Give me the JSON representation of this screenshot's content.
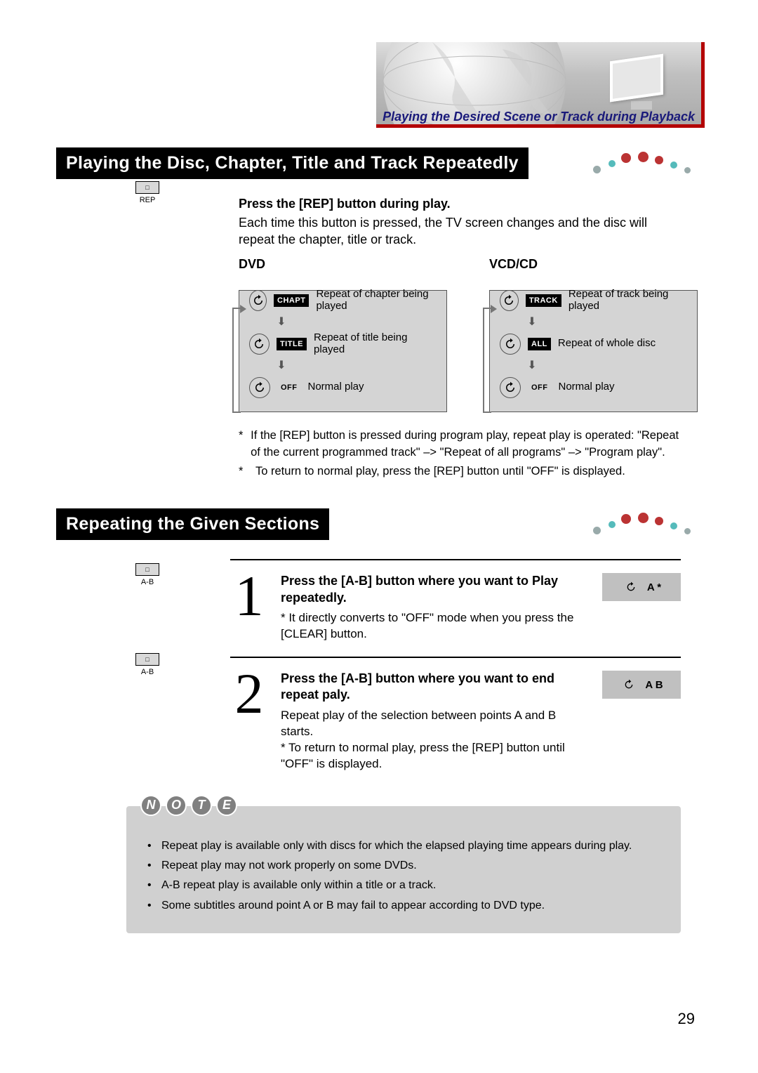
{
  "header": {
    "section_link": "Playing the Desired Scene or Track during Playback"
  },
  "h1": "Playing the Disc, Chapter, Title and Track Repeatedly",
  "intro": {
    "sub": "Press the [REP] button during play.",
    "txt": "Each time this button is pressed, the TV screen changes and the disc will  repeat the chapter, title or track.",
    "btn_label": "REP"
  },
  "flow": {
    "dvd": {
      "title": "DVD",
      "rows": [
        {
          "tag": "CHAPT",
          "desc": "Repeat of chapter being played"
        },
        {
          "tag": "TITLE",
          "desc": "Repeat of title being played"
        },
        {
          "tag": "OFF",
          "desc": "Normal play",
          "off": true
        }
      ]
    },
    "vcd": {
      "title": "VCD/CD",
      "rows": [
        {
          "tag": "TRACK",
          "desc": "Repeat of track being played"
        },
        {
          "tag": "ALL",
          "desc": "Repeat of whole disc"
        },
        {
          "tag": "OFF",
          "desc": "Normal play",
          "off": true
        }
      ]
    }
  },
  "bullets1": [
    "If the [REP] button is pressed during program play, repeat play is operated: \"Repeat of the current programmed track\" –> \"Repeat of all programs\" –> \"Program play\".",
    "To return to normal play, press the [REP] button until \"OFF\" is displayed."
  ],
  "h2": "Repeating the Given Sections",
  "steps": [
    {
      "num": "1",
      "h": "Press the [A-B] button where you want to Play repeatedly.",
      "p": "*  It directly converts to \"OFF\" mode when you press the [CLEAR] button.",
      "osd": "A   *",
      "btn_label": "A-B"
    },
    {
      "num": "2",
      "h": "Press the [A-B] button where you want to end repeat paly.",
      "p": "Repeat play of the selection between points A and B starts.\n*  To return to normal play, press the [REP] button until \"OFF\" is displayed.",
      "osd": "A   B",
      "btn_label": "A-B"
    }
  ],
  "note": {
    "label": [
      "N",
      "O",
      "T",
      "E"
    ],
    "items": [
      "Repeat play is available only with discs for which the elapsed playing time  appears during play.",
      "Repeat play may not work properly on some DVDs.",
      "A-B repeat play is available only within a title or a track.",
      "Some subtitles around point A or B may fail to appear according to DVD type."
    ]
  },
  "page_number": "29"
}
